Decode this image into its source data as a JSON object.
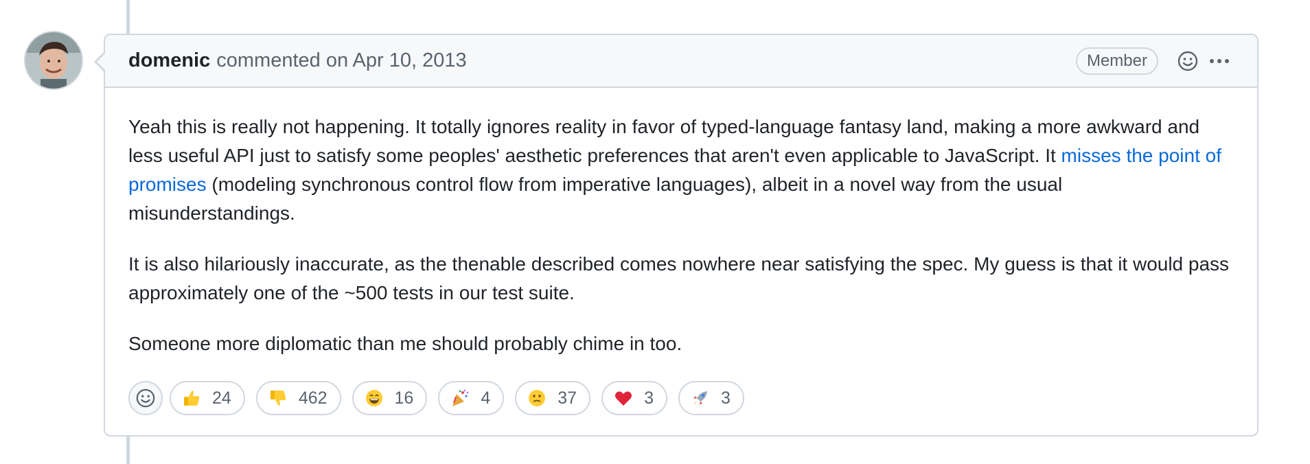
{
  "comment": {
    "author": "domenic",
    "meta": "commented on Apr 10, 2013",
    "badge": "Member",
    "paragraphs": {
      "p1_before_link": "Yeah this is really not happening. It totally ignores reality in favor of typed-language fantasy land, making a more awkward and less useful API just to satisfy some peoples' aesthetic preferences that aren't even applicable to JavaScript. It ",
      "p1_link": "misses the point of promises",
      "p1_after_link": " (modeling synchronous control flow from imperative languages), albeit in a novel way from the usual misunderstandings.",
      "p2": "It is also hilariously inaccurate, as the thenable described comes nowhere near satisfying the spec. My guess is that it would pass approximately one of the ~500 tests in our test suite.",
      "p3": "Someone more diplomatic than me should probably chime in too."
    }
  },
  "reactions": [
    {
      "icon": "thumbs-up-icon",
      "count": "24"
    },
    {
      "icon": "thumbs-down-icon",
      "count": "462"
    },
    {
      "icon": "laugh-icon",
      "count": "16"
    },
    {
      "icon": "hooray-icon",
      "count": "4"
    },
    {
      "icon": "confused-icon",
      "count": "37"
    },
    {
      "icon": "heart-icon",
      "count": "3"
    },
    {
      "icon": "rocket-icon",
      "count": "3"
    }
  ],
  "colors": {
    "link": "#0969da",
    "border": "#d0d7de",
    "header_bg": "#f6f8fa",
    "muted_text": "#59636e",
    "text": "#1f2328"
  }
}
